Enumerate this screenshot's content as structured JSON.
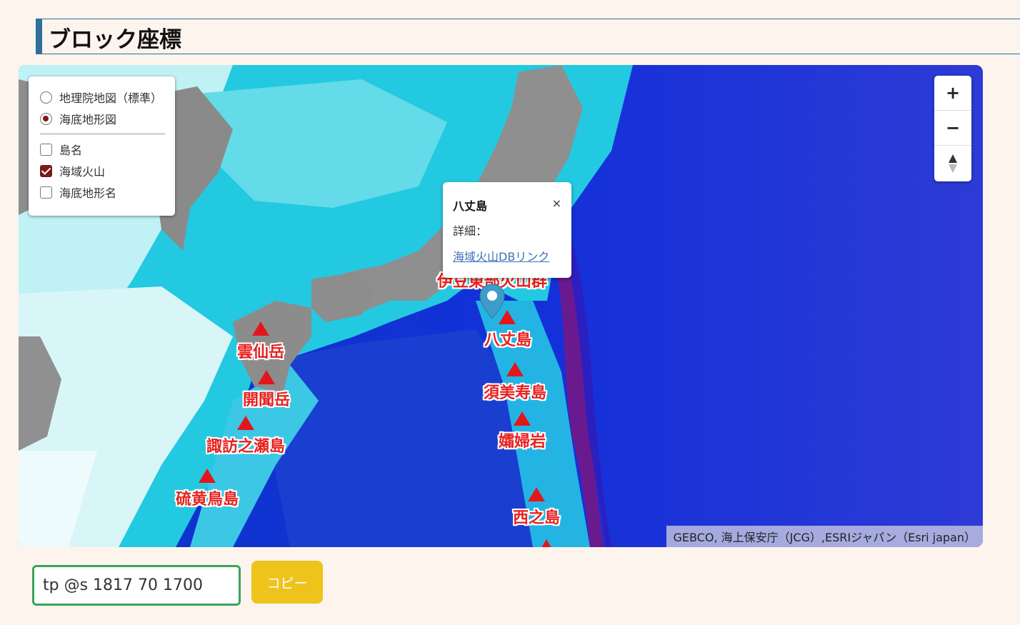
{
  "heading": "ブロック座標",
  "layer_control": {
    "base_layers": [
      {
        "label": "地理院地図（標準）",
        "selected": false
      },
      {
        "label": "海底地形図",
        "selected": true
      }
    ],
    "overlays": [
      {
        "label": "島名",
        "checked": false
      },
      {
        "label": "海域火山",
        "checked": true
      },
      {
        "label": "海底地形名",
        "checked": false
      }
    ]
  },
  "zoom_control": {
    "zoom_in": "+",
    "zoom_out": "−",
    "reset_north": "▲"
  },
  "popup": {
    "title": "八丈島",
    "detail_label": "詳細：",
    "link_text": "海域火山DBリンク",
    "close": "×"
  },
  "volcanoes": [
    {
      "name": "伊豆東部火山群"
    },
    {
      "name": "八丈島"
    },
    {
      "name": "須美寿島"
    },
    {
      "name": "孀婦岩"
    },
    {
      "name": "西之島"
    },
    {
      "name": "雲仙岳"
    },
    {
      "name": "開聞岳"
    },
    {
      "name": "諏訪之瀬島"
    },
    {
      "name": "硫黄鳥島"
    }
  ],
  "attribution": "GEBCO, 海上保安庁（JCG）,ESRIジャパン（Esri japan）",
  "coordinate_input": {
    "value": "tp @s 1817 70 1700"
  },
  "copy_button": "コピー",
  "colors": {
    "heading_border": "#2e6f9e",
    "page_background": "#fdf4ee",
    "copy_button": "#eec31b",
    "input_border": "#3aa35c",
    "volcano_marker": "#e3161b"
  }
}
